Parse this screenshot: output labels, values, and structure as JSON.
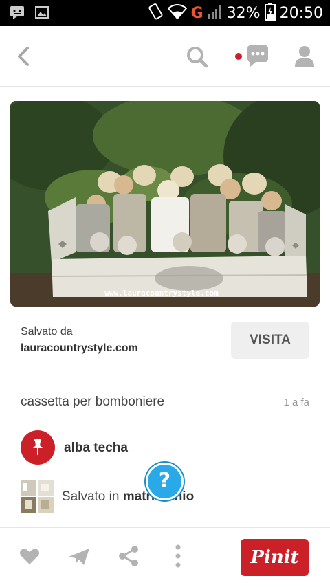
{
  "status_bar": {
    "network": "G",
    "battery": "32%",
    "time": "20:50"
  },
  "pin": {
    "image_watermark": "www.lauracountrystyle.com",
    "saved_from_label": "Salvato da",
    "source_site": "lauracountrystyle.com",
    "visit_label": "VISITA",
    "description": "cassetta per bomboniere",
    "time_ago": "1 a fa",
    "user_name": "alba techa",
    "saved_in_prefix": "Salvato in",
    "board_name": "matrimonio",
    "help_label": "?"
  },
  "toolbar": {
    "pin_it_label": "Pinit"
  },
  "colors": {
    "brand_red": "#cb2027",
    "help_blue": "#29a9e8",
    "icon_gray": "#b3b3b3"
  },
  "icons": [
    "back-icon",
    "search-icon",
    "notification-dot-icon",
    "messages-icon",
    "profile-icon",
    "heart-icon",
    "send-icon",
    "share-icon",
    "more-icon",
    "pin-icon",
    "help-icon"
  ]
}
